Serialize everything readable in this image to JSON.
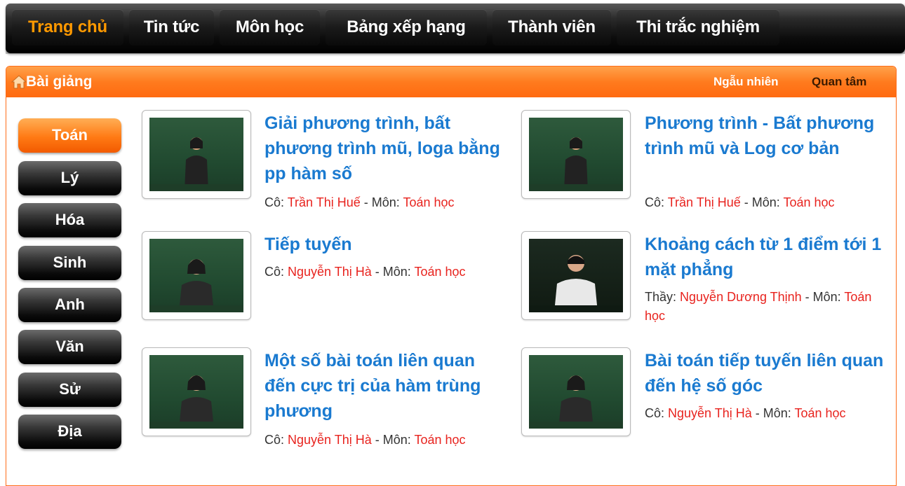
{
  "nav": {
    "items": [
      "Trang chủ",
      "Tin tức",
      "Môn học",
      "Bảng xếp hạng",
      "Thành viên",
      "Thi trắc nghiệm"
    ]
  },
  "panel": {
    "title": "Bài giảng",
    "link_random": "Ngẫu nhiên",
    "link_care": "Quan tâm"
  },
  "subjects": [
    "Toán",
    "Lý",
    "Hóa",
    "Sinh",
    "Anh",
    "Văn",
    "Sử",
    "Địa"
  ],
  "lessons": [
    {
      "title": "Giải phương trình, bất phương trình mũ, loga bằng pp hàm số",
      "teacher_prefix": "Cô: ",
      "teacher": "Trần Thị Huế",
      "subject_prefix": " - Môn: ",
      "subject": "Toán học"
    },
    {
      "title": "Phương trình - Bất phương trình mũ và Log cơ bản",
      "teacher_prefix": "Cô: ",
      "teacher": "Trần Thị Huế",
      "subject_prefix": " - Môn: ",
      "subject": "Toán học"
    },
    {
      "title": "Tiếp tuyến",
      "teacher_prefix": "Cô: ",
      "teacher": "Nguyễn Thị Hà",
      "subject_prefix": " - Môn: ",
      "subject": "Toán học"
    },
    {
      "title": "Khoảng cách từ 1 điểm tới 1 mặt phẳng",
      "teacher_prefix": "Thầy: ",
      "teacher": "Nguyễn Dương Thịnh",
      "subject_prefix": " - Môn: ",
      "subject": "Toán học"
    },
    {
      "title": "Một số bài toán liên quan đến cực trị của hàm trùng phương",
      "teacher_prefix": "Cô: ",
      "teacher": "Nguyễn Thị Hà",
      "subject_prefix": " - Môn: ",
      "subject": "Toán học"
    },
    {
      "title": "Bài toán tiếp tuyến liên quan đến hệ số góc",
      "teacher_prefix": "Cô: ",
      "teacher": "Nguyễn Thị Hà",
      "subject_prefix": " - Môn: ",
      "subject": "Toán học"
    }
  ],
  "colors": {
    "accent": "#ff7a14",
    "link": "#1a7ad0",
    "red": "#e8231e"
  }
}
